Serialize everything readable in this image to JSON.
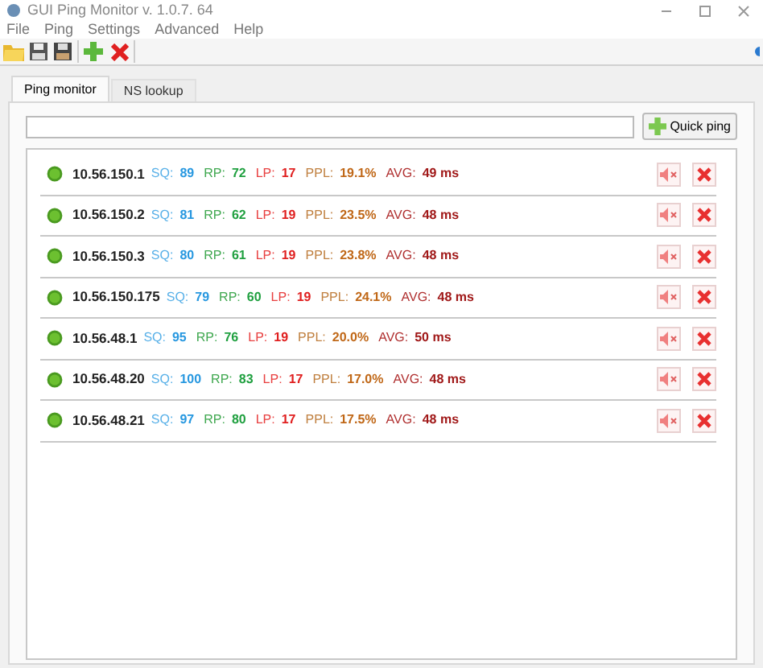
{
  "window": {
    "title": "GUI Ping Monitor v. 1.0.7. 64"
  },
  "menu": [
    "File",
    "Ping",
    "Settings",
    "Advanced",
    "Help"
  ],
  "tabs": [
    {
      "label": "Ping monitor",
      "selected": true
    },
    {
      "label": "NS lookup",
      "selected": false
    }
  ],
  "quick_ping": {
    "button": "Quick ping"
  },
  "hosts": [
    {
      "online": true,
      "ip": "10.56.150.1",
      "sq_label": "SQ:",
      "sq": "89",
      "rp_label": "RP:",
      "rp": "72",
      "lp_label": "LP:",
      "lp": "17",
      "ppl_label": "PPL:",
      "ppl": "19.1%",
      "avg_label": "AVG:",
      "avg": "49 ms"
    },
    {
      "online": true,
      "ip": "10.56.150.2",
      "sq_label": "SQ:",
      "sq": "81",
      "rp_label": "RP:",
      "rp": "62",
      "lp_label": "LP:",
      "lp": "19",
      "ppl_label": "PPL:",
      "ppl": "23.5%",
      "avg_label": "AVG:",
      "avg": "48 ms"
    },
    {
      "online": true,
      "ip": "10.56.150.3",
      "sq_label": "SQ:",
      "sq": "80",
      "rp_label": "RP:",
      "rp": "61",
      "lp_label": "LP:",
      "lp": "19",
      "ppl_label": "PPL:",
      "ppl": "23.8%",
      "avg_label": "AVG:",
      "avg": "48 ms"
    },
    {
      "online": true,
      "ip": "10.56.150.175",
      "sq_label": "SQ:",
      "sq": "79",
      "rp_label": "RP:",
      "rp": "60",
      "lp_label": "LP:",
      "lp": "19",
      "ppl_label": "PPL:",
      "ppl": "24.1%",
      "avg_label": "AVG:",
      "avg": "48 ms"
    },
    {
      "online": true,
      "ip": "10.56.48.1",
      "sq_label": "SQ:",
      "sq": "95",
      "rp_label": "RP:",
      "rp": "76",
      "lp_label": "LP:",
      "lp": "19",
      "ppl_label": "PPL:",
      "ppl": "20.0%",
      "avg_label": "AVG:",
      "avg": "50 ms"
    },
    {
      "online": true,
      "ip": "10.56.48.20",
      "sq_label": "SQ:",
      "sq": "100",
      "rp_label": "RP:",
      "rp": "83",
      "lp_label": "LP:",
      "lp": "17",
      "ppl_label": "PPL:",
      "ppl": "17.0%",
      "avg_label": "AVG:",
      "avg": "48 ms"
    },
    {
      "online": true,
      "ip": "10.56.48.21",
      "sq_label": "SQ:",
      "sq": "97",
      "rp_label": "RP:",
      "rp": "80",
      "lp_label": "LP:",
      "lp": "17",
      "ppl_label": "PPL:",
      "ppl": "17.5%",
      "avg_label": "AVG:",
      "avg": "48 ms"
    }
  ]
}
